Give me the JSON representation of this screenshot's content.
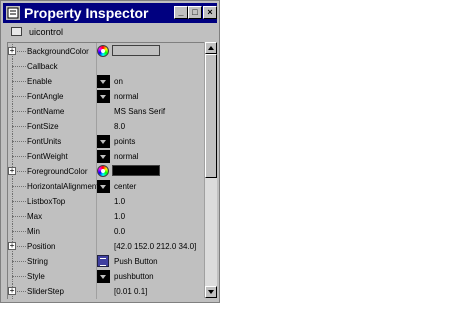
{
  "window": {
    "title": "Property Inspector",
    "buttons": {
      "minimize": "_",
      "maximize": "□",
      "close": "×"
    }
  },
  "object": {
    "label": "uicontrol",
    "icon": "uicontrol-icon"
  },
  "colors": {
    "titlebar": "#000080",
    "background_color_swatch": "#c0c0c0",
    "foreground_color_swatch": "#000000"
  },
  "properties": [
    {
      "name": "BackgroundColor",
      "value": "",
      "control": "color",
      "expandable": true
    },
    {
      "name": "Callback",
      "value": "",
      "control": "none",
      "expandable": false
    },
    {
      "name": "Enable",
      "value": "on",
      "control": "dropdown",
      "expandable": false
    },
    {
      "name": "FontAngle",
      "value": "normal",
      "control": "dropdown",
      "expandable": false
    },
    {
      "name": "FontName",
      "value": "MS Sans Serif",
      "control": "none",
      "expandable": false
    },
    {
      "name": "FontSize",
      "value": "8.0",
      "control": "none",
      "expandable": false
    },
    {
      "name": "FontUnits",
      "value": "points",
      "control": "dropdown",
      "expandable": false
    },
    {
      "name": "FontWeight",
      "value": "normal",
      "control": "dropdown",
      "expandable": false
    },
    {
      "name": "ForegroundColor",
      "value": "",
      "control": "color",
      "expandable": true
    },
    {
      "name": "HorizontalAlignment",
      "value": "center",
      "control": "dropdown",
      "expandable": false
    },
    {
      "name": "ListboxTop",
      "value": "1.0",
      "control": "none",
      "expandable": false
    },
    {
      "name": "Max",
      "value": "1.0",
      "control": "none",
      "expandable": false
    },
    {
      "name": "Min",
      "value": "0.0",
      "control": "none",
      "expandable": false
    },
    {
      "name": "Position",
      "value": "[42.0 152.0 212.0 34.0]",
      "control": "none",
      "expandable": true
    },
    {
      "name": "String",
      "value": "Push Button",
      "control": "string",
      "expandable": false
    },
    {
      "name": "Style",
      "value": "pushbutton",
      "control": "dropdown",
      "expandable": false
    },
    {
      "name": "SliderStep",
      "value": "[0.01 0.1]",
      "control": "none",
      "expandable": true
    }
  ],
  "scrollbar": {
    "position_fraction": 0.0
  }
}
